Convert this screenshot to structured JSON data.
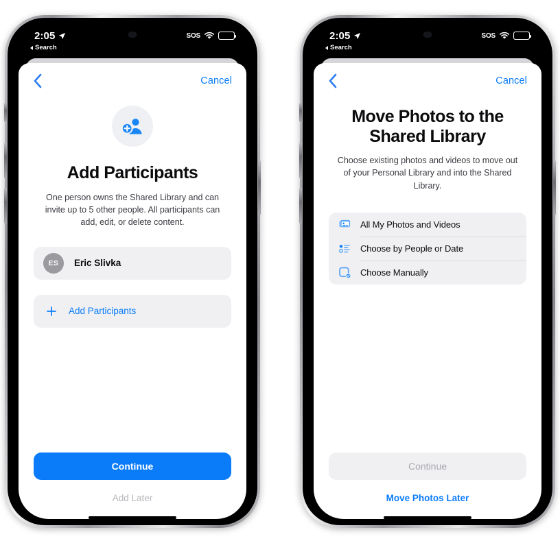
{
  "status_bar": {
    "time": "2:05",
    "back_app": "Search",
    "carrier": "SOS",
    "location_icon": "location-arrow-icon",
    "wifi_icon": "wifi-icon",
    "battery_icon": "battery-icon"
  },
  "phones": [
    {
      "nav": {
        "back_icon": "chevron-left-icon",
        "cancel_label": "Cancel"
      },
      "hero_icon": "person-add-icon",
      "title": "Add Participants",
      "description": "One person owns the Shared Library and can invite up to 5 other people. All participants can add, edit, or delete content.",
      "participants": [
        {
          "initials": "ES",
          "name": "Eric Slivka"
        }
      ],
      "add_row": {
        "icon": "plus-icon",
        "label": "Add Participants"
      },
      "primary_button": {
        "label": "Continue",
        "state": "enabled"
      },
      "secondary_button": {
        "label": "Add Later",
        "state": "muted"
      }
    },
    {
      "nav": {
        "back_icon": "chevron-left-icon",
        "cancel_label": "Cancel"
      },
      "title": "Move Photos to the Shared Library",
      "description": "Choose existing photos and videos to move out of your Personal Library and into the Shared Library.",
      "options": [
        {
          "icon": "photo-stack-icon",
          "label": "All My Photos and Videos"
        },
        {
          "icon": "list-bullet-icon",
          "label": "Choose by People or Date"
        },
        {
          "icon": "square-check-icon",
          "label": "Choose Manually"
        }
      ],
      "primary_button": {
        "label": "Continue",
        "state": "disabled"
      },
      "secondary_button": {
        "label": "Move Photos Later",
        "state": "link"
      }
    }
  ],
  "colors": {
    "accent_blue": "#0a7cfa",
    "card_gray": "#f0f0f3",
    "avatar_gray": "#9a9a9f",
    "text_primary": "#0b0b0d"
  }
}
